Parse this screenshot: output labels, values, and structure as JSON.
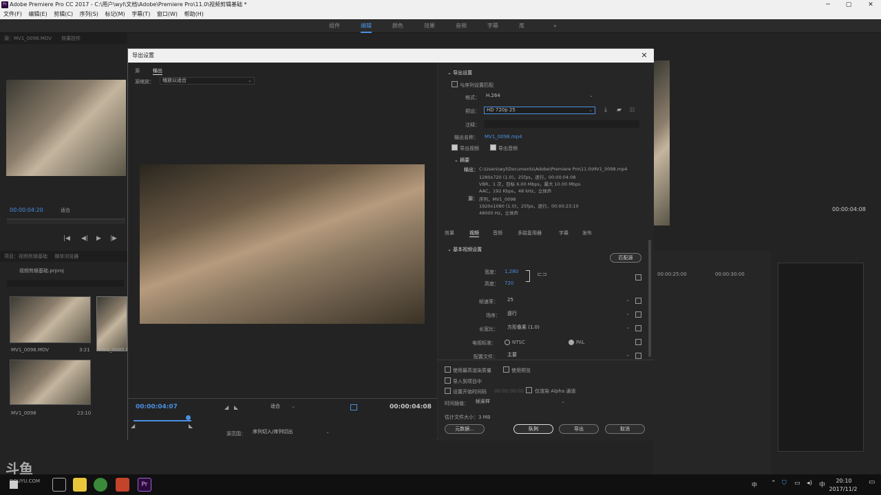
{
  "window": {
    "title": "Adobe Premiere Pro CC 2017 - C:\\用户\\wyl\\文档\\Adobe\\Premiere Pro\\11.0\\视频剪辑基础 *",
    "app_icon": "Pr"
  },
  "menu": [
    "文件(F)",
    "编辑(E)",
    "剪辑(C)",
    "序列(S)",
    "标记(M)",
    "字幕(T)",
    "窗口(W)",
    "帮助(H)"
  ],
  "workspaces": [
    "组件",
    "编辑",
    "颜色",
    "效果",
    "音频",
    "字幕",
    "库"
  ],
  "source_panel": {
    "tab": "源：MV1_0098.MOV",
    "tab2": "效果控件",
    "tab3": "音频剪辑混合器：MV1",
    "tab4": "节目：MV1_0098",
    "timecode": "00:00:04:20",
    "fit": "适合"
  },
  "project_panel": {
    "tab": "项目：视频剪辑基础",
    "tab2": "媒体浏览器",
    "project_file": "视频剪辑基础.prproj",
    "items": [
      {
        "name": "MV1_0098.MOV",
        "duration": "3:21"
      },
      {
        "name": "MV1_0085.M",
        "duration": ""
      },
      {
        "name": "MV1_0098",
        "duration": "23:10"
      }
    ]
  },
  "program_panel": {
    "timecode": "00:00:04:08"
  },
  "timeline": {
    "ruler": [
      "00:00:25:00",
      "00:00:30:00"
    ]
  },
  "dialog": {
    "title": "导出设置",
    "left_tabs": [
      "源",
      "输出"
    ],
    "source_scaling_label": "源缩放：",
    "source_scaling_value": "缩放以适合",
    "current_time": "00:00:04:07",
    "fit_value": "适合",
    "end_time": "00:00:04:08",
    "source_range_label": "源范围：",
    "source_range_value": "序列切入/序列切出",
    "export_settings": {
      "header": "导出设置",
      "match_sequence": "与序列设置匹配",
      "format_label": "格式：",
      "format_value": "H.264",
      "preset_label": "预设：",
      "preset_value": "HD 720p 25",
      "comments_label": "注释：",
      "output_name_label": "输出名称：",
      "output_name_value": "MV1_0098.mp4",
      "export_video": "导出视频",
      "export_audio": "导出音频",
      "summary_header": "摘要",
      "output_label": "输出：",
      "output_lines": [
        "C:\\Users\\wyl\\Documents\\Adobe\\Premiere Pro\\11.0\\MV1_0098.mp4",
        "1280x720 (1.0)，25fps，逐行，00:00:04:08",
        "VBR，1 次，目标 6.00 Mbps，最大 10.00 Mbps",
        "AAC，192 Kbps，48 kHz，立体声"
      ],
      "source_label": "源：",
      "source_lines": [
        "序列，MV1_0098",
        "1920x1080 (1.0)，25fps，逐行，00:00:23:10",
        "48000 Hz，立体声"
      ]
    },
    "tabs": [
      "效果",
      "视频",
      "音频",
      "多路复用器",
      "字幕",
      "发布"
    ],
    "basic_video": {
      "header": "基本视频设置",
      "match_source": "匹配源",
      "width_label": "宽度：",
      "width_value": "1,280",
      "height_label": "高度：",
      "height_value": "720",
      "fps_label": "帧速率：",
      "fps_value": "25",
      "field_label": "场序：",
      "field_value": "逐行",
      "aspect_label": "长宽比：",
      "aspect_value": "方形像素 (1.0)",
      "tv_label": "电视标准：",
      "ntsc": "NTSC",
      "pal": "PAL",
      "profile_label": "配置文件：",
      "profile_value": "主要"
    },
    "bottom": {
      "max_render": "使用最高渲染质量",
      "use_previews": "使用预览",
      "import_project": "导入到项目中",
      "set_start_tc": "设置开始时间码",
      "start_tc_value": "00:00:00:00",
      "render_alpha": "仅渲染 Alpha 通道",
      "interp_label": "时间插值：",
      "interp_value": "帧采样",
      "est_size": "估计文件大小：3 MB",
      "metadata": "元数据...",
      "queue": "队列",
      "export": "导出",
      "cancel": "取消"
    }
  },
  "watermark": {
    "text": "斗鱼",
    "sub": "DOUYU.COM"
  },
  "taskbar": {
    "time": "20:10",
    "date": "2017/11/2",
    "lang": "中"
  },
  "colors": {
    "accent": "#4a90e2",
    "dark": "#232323"
  }
}
